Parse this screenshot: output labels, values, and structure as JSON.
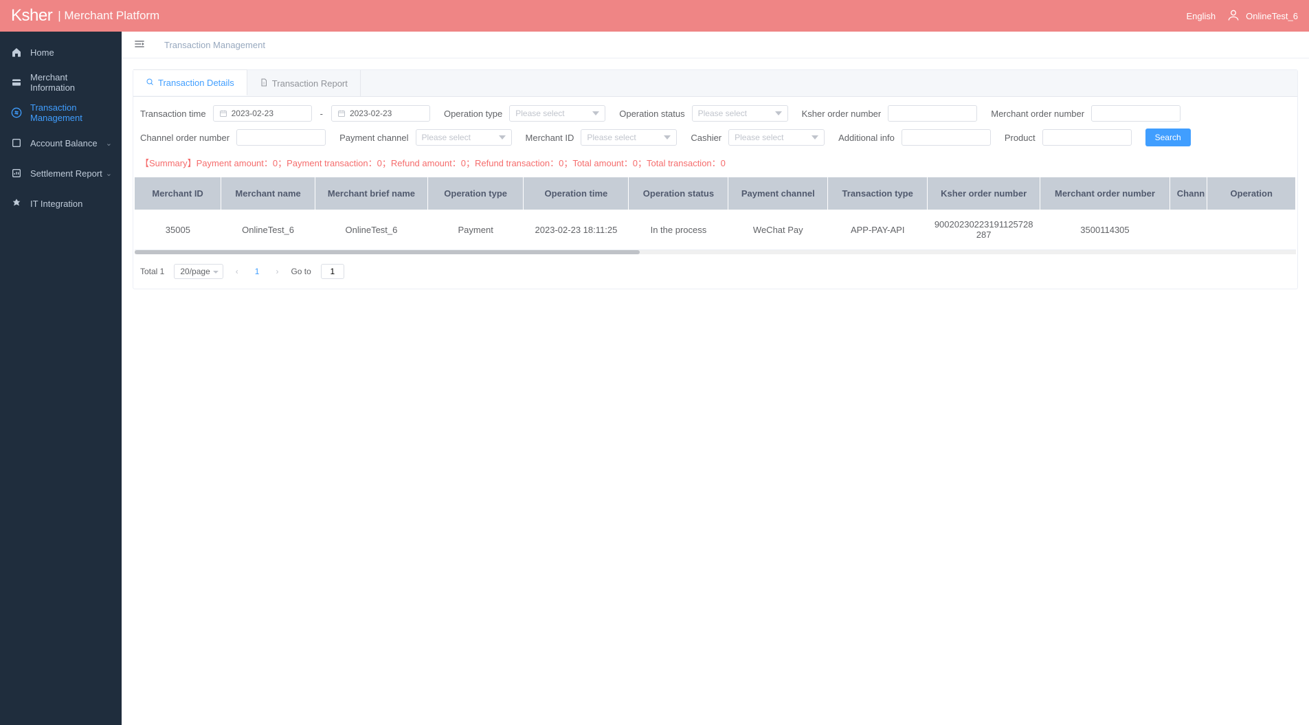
{
  "header": {
    "brand": "Ksher",
    "brand_sub": "|  Merchant Platform",
    "lang": "English",
    "user": "OnlineTest_6"
  },
  "sidebar": {
    "items": [
      {
        "label": "Home",
        "icon": "home",
        "expandable": false
      },
      {
        "label": "Merchant Information",
        "icon": "card",
        "expandable": false
      },
      {
        "label": "Transaction Management",
        "icon": "exchange",
        "expandable": false,
        "active": true
      },
      {
        "label": "Account Balance",
        "icon": "balance",
        "expandable": true
      },
      {
        "label": "Settlement Report",
        "icon": "report",
        "expandable": true
      },
      {
        "label": "IT Integration",
        "icon": "plugin",
        "expandable": false
      }
    ]
  },
  "breadcrumb": {
    "title": "Transaction Management"
  },
  "tabs": [
    {
      "label": "Transaction Details",
      "active": true
    },
    {
      "label": "Transaction Report",
      "active": false
    }
  ],
  "filters": {
    "transaction_time_label": "Transaction time",
    "date_from": "2023-02-23",
    "date_to": "2023-02-23",
    "operation_type_label": "Operation type",
    "operation_type_placeholder": "Please select",
    "operation_status_label": "Operation status",
    "operation_status_placeholder": "Please select",
    "ksher_order_label": "Ksher order number",
    "merchant_order_label": "Merchant order number",
    "channel_order_label": "Channel order number",
    "payment_channel_label": "Payment channel",
    "payment_channel_placeholder": "Please select",
    "merchant_id_label": "Merchant ID",
    "merchant_id_placeholder": "Please select",
    "cashier_label": "Cashier",
    "cashier_placeholder": "Please select",
    "additional_info_label": "Additional info",
    "product_label": "Product",
    "search_label": "Search"
  },
  "summary": "【Summary】Payment amount：0；Payment transaction：0；Refund amount：0；Refund transaction：0；Total amount：0；Total transaction：0",
  "table": {
    "headers": [
      "Merchant ID",
      "Merchant name",
      "Merchant brief name",
      "Operation type",
      "Operation time",
      "Operation status",
      "Payment channel",
      "Transaction type",
      "Ksher order number",
      "Merchant order number",
      "Chann",
      "Operation"
    ],
    "rows": [
      {
        "merchant_id": "35005",
        "merchant_name": "OnlineTest_6",
        "merchant_brief": "OnlineTest_6",
        "op_type": "Payment",
        "op_time": "2023-02-23 18:11:25",
        "op_status": "In the process",
        "pay_channel": "WeChat Pay",
        "tx_type": "APP-PAY-API",
        "ksher_order": "90020230223191125728287",
        "merchant_order": "3500114305",
        "channel": "",
        "operation": ""
      }
    ]
  },
  "pagination": {
    "total_label": "Total 1",
    "page_size": "20/page",
    "current": "1",
    "goto_label": "Go to",
    "goto_value": "1"
  }
}
